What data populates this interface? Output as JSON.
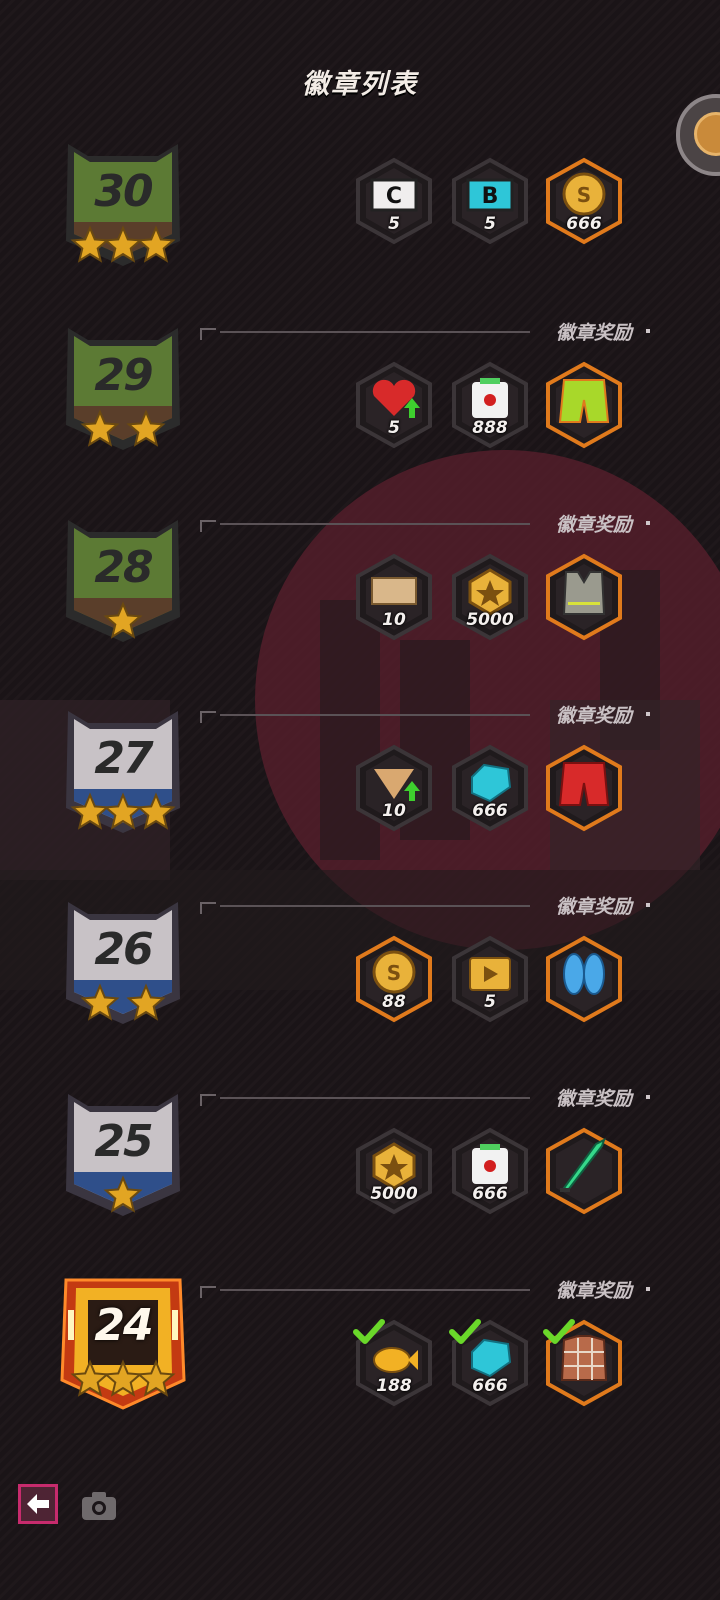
{
  "screen": {
    "title": "徽章列表"
  },
  "colors": {
    "accent": "#c72b6d",
    "gold": "#f2b124",
    "green_badge": "#5c7a34",
    "gray_badge": "#c8c2c6"
  },
  "rows": [
    {
      "level": "30",
      "stars": 3,
      "style": "green",
      "reward_label": "",
      "rewards": [
        {
          "icon": "c-ticket-icon",
          "count": "5",
          "claimed": false
        },
        {
          "icon": "b-ticket-icon",
          "count": "5",
          "claimed": false
        },
        {
          "icon": "s-coin-icon",
          "count": "666",
          "claimed": false
        }
      ]
    },
    {
      "level": "29",
      "stars": 2,
      "style": "green",
      "reward_label": "徽章奖励",
      "rewards": [
        {
          "icon": "heart-upgrade-icon",
          "count": "5",
          "claimed": false
        },
        {
          "icon": "dice-card-icon",
          "count": "888",
          "claimed": false
        },
        {
          "icon": "shorts-green-icon",
          "count": "",
          "claimed": false
        }
      ]
    },
    {
      "level": "28",
      "stars": 1,
      "style": "green",
      "reward_label": "徽章奖励",
      "rewards": [
        {
          "icon": "ticket-icon",
          "count": "10",
          "claimed": false
        },
        {
          "icon": "star-coin-icon",
          "count": "5000",
          "claimed": false
        },
        {
          "icon": "vest-icon",
          "count": "",
          "claimed": false
        }
      ]
    },
    {
      "level": "27",
      "stars": 3,
      "style": "gray",
      "reward_label": "徽章奖励",
      "rewards": [
        {
          "icon": "shard-upgrade-icon",
          "count": "10",
          "claimed": false
        },
        {
          "icon": "blue-gem-icon",
          "count": "666",
          "claimed": false
        },
        {
          "icon": "shorts-red-icon",
          "count": "",
          "claimed": false
        }
      ]
    },
    {
      "level": "26",
      "stars": 2,
      "style": "gray",
      "reward_label": "徽章奖励",
      "rewards": [
        {
          "icon": "s-coin-icon",
          "count": "88",
          "claimed": false
        },
        {
          "icon": "video-card-icon",
          "count": "5",
          "claimed": false
        },
        {
          "icon": "blue-shoes-icon",
          "count": "",
          "claimed": false
        }
      ]
    },
    {
      "level": "25",
      "stars": 1,
      "style": "gray",
      "reward_label": "徽章奖励",
      "rewards": [
        {
          "icon": "star-coin-icon",
          "count": "5000",
          "claimed": false
        },
        {
          "icon": "dice-card-icon",
          "count": "666",
          "claimed": false
        },
        {
          "icon": "green-sword-icon",
          "count": "",
          "claimed": false
        }
      ]
    },
    {
      "level": "24",
      "stars": 3,
      "style": "gold",
      "reward_label": "徽章奖励",
      "rewards": [
        {
          "icon": "fish-icon",
          "count": "188",
          "claimed": true
        },
        {
          "icon": "blue-gem-icon",
          "count": "666",
          "claimed": true
        },
        {
          "icon": "plaid-shirt-icon",
          "count": "",
          "claimed": true
        }
      ]
    }
  ]
}
